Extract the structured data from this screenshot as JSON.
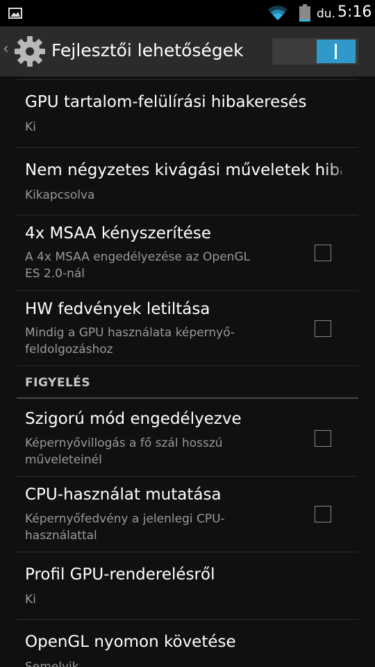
{
  "status_bar": {
    "ampm": "du.",
    "time": "5:16"
  },
  "action_bar": {
    "title": "Fejlesztői lehetőségek",
    "master_switch_on": true
  },
  "items": [
    {
      "title": "GPU tartalom-felülírási hibakeresés",
      "summary": "Ki"
    },
    {
      "title": "Nem négyzetes kivágási műveletek hibakeresése",
      "summary": "Kikapcsolva"
    },
    {
      "title": "4x MSAA kényszerítése",
      "summary_line1": "A 4x MSAA engedélyezése az OpenGL",
      "summary_line2": "ES 2.0-nál",
      "checked": false
    },
    {
      "title": "HW fedvények letiltása",
      "summary_line1": "Mindig a GPU használata képernyő-",
      "summary_line2": "feldolgozáshoz",
      "checked": false
    }
  ],
  "section_monitoring": {
    "header": "FIGYELÉS"
  },
  "items2": [
    {
      "title": "Szigorú mód engedélyezve",
      "summary_line1": "Képernyővillogás a fő szál hosszú",
      "summary_line2": "műveleteinél",
      "checked": false
    },
    {
      "title": "CPU-használat mutatása",
      "summary_line1": "Képernyőfedvény a jelenlegi CPU-",
      "summary_line2": "használattal",
      "checked": false
    },
    {
      "title": "Profil GPU-renderelésről",
      "summary": "Ki"
    },
    {
      "title": "OpenGL nyomon követése",
      "summary": "Semelyik"
    }
  ]
}
